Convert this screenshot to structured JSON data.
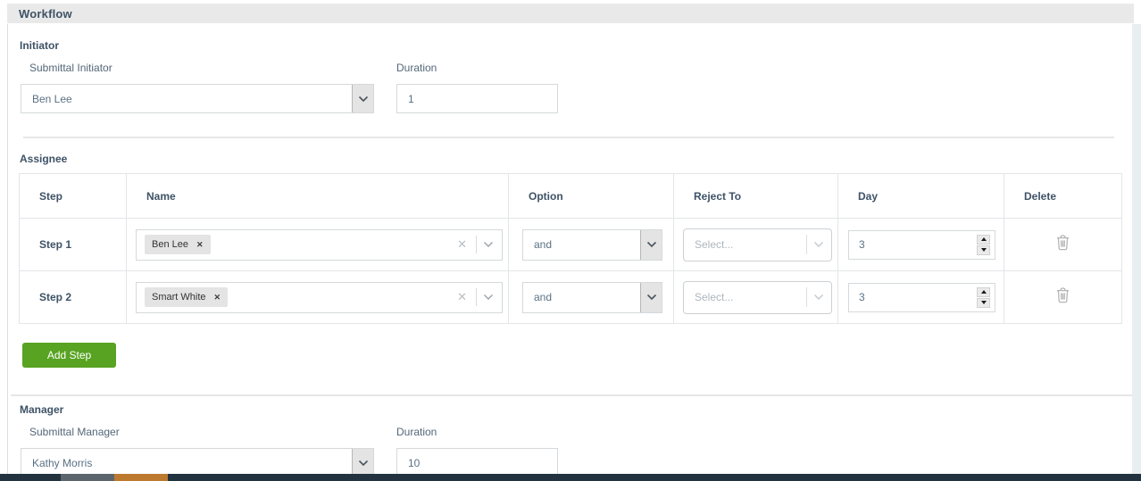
{
  "page": {
    "title": "Workflow"
  },
  "glyphs": {
    "tag_remove": "✕",
    "clear": "✕"
  },
  "initiator": {
    "heading": "Initiator",
    "submittal_label": "Submittal Initiator",
    "submittal_value": "Ben Lee",
    "duration_label": "Duration",
    "duration_value": "1"
  },
  "assignee": {
    "heading": "Assignee",
    "columns": {
      "step": "Step",
      "name": "Name",
      "option": "Option",
      "reject_to": "Reject To",
      "day": "Day",
      "delete": "Delete"
    },
    "rows": [
      {
        "step": "Step 1",
        "tag": "Ben Lee",
        "option": "and",
        "reject_placeholder": "Select...",
        "day": "3"
      },
      {
        "step": "Step 2",
        "tag": "Smart White",
        "option": "and",
        "reject_placeholder": "Select...",
        "day": "3"
      }
    ],
    "add_step_label": "Add Step"
  },
  "manager": {
    "heading": "Manager",
    "submittal_label": "Submittal Manager",
    "submittal_value": "Kathy Morris",
    "duration_label": "Duration",
    "duration_value": "10"
  },
  "colors": {
    "accent_green": "#58a322",
    "header_bg": "#e9e9e9",
    "heading_text": "#3e5266",
    "footer_bg": "#22333f",
    "footer_gray": "#5b656d",
    "footer_orange": "#bd7a2e"
  }
}
